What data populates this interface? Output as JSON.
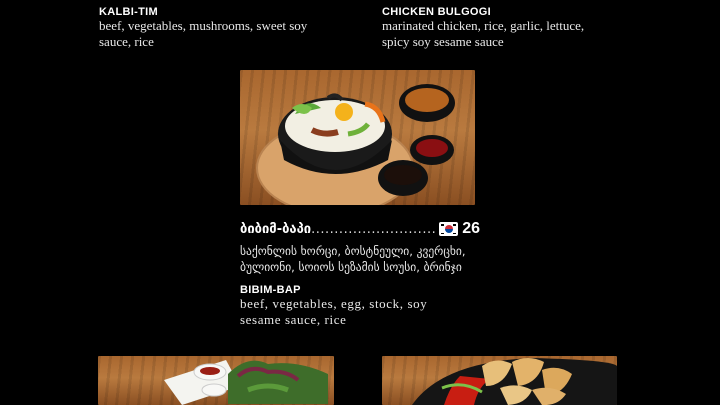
{
  "items": {
    "kalbi": {
      "title": "KALBI-TIM",
      "desc": "beef, vegetables, mushrooms, sweet soy sauce, rice"
    },
    "bulgogi": {
      "title": "CHICKEN BULGOGI",
      "desc": "marinated chicken, rice, garlic, lettuce, spicy soy sesame sauce"
    },
    "bibimbap": {
      "geo_name": "ბიბიმ-ბაპი",
      "dots": "........................................",
      "price": "26",
      "geo_desc": "საქონლის ხორცი, ბოსტნეული, კვერცხი, ბულიონი, სოიოს სეზამის სოუსი, ბრინჯი",
      "title": "BIBIM-BAP",
      "desc": "beef, vegetables, egg, stock, soy sesame sauce, rice"
    }
  },
  "icons": {
    "flag": "south-korea-flag-icon"
  },
  "colors": {
    "background": "#000000",
    "text": "#ffffff",
    "wood": "#a9672f"
  }
}
